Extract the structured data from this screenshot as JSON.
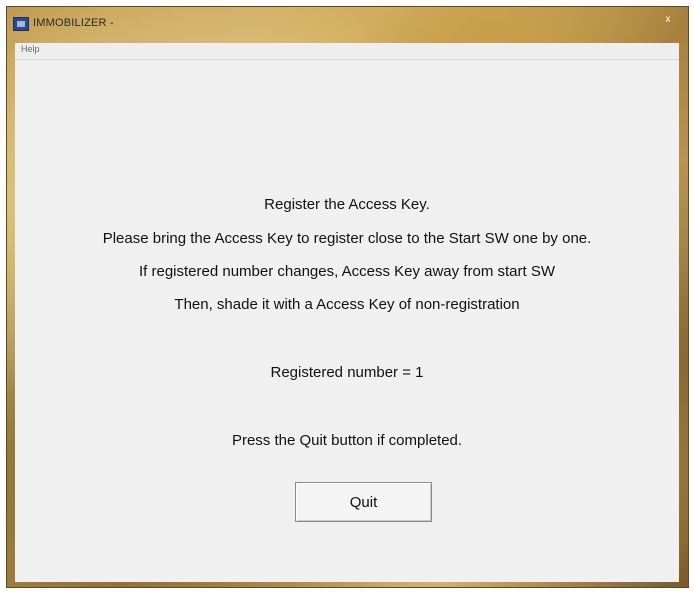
{
  "window": {
    "title": "IMMOBILIZER -",
    "close_glyph": "x"
  },
  "menu": {
    "items": [
      "Help"
    ]
  },
  "content": {
    "lines": [
      "Register the Access Key.",
      "Please bring the Access Key to register close to the Start SW one by one.",
      "If registered number changes, Access Key away from start SW",
      "Then, shade it with a Access Key of non-registration"
    ],
    "registered_label": "Registered number =  1",
    "instruction": "Press the Quit button if completed."
  },
  "buttons": {
    "quit_label": "Quit"
  }
}
